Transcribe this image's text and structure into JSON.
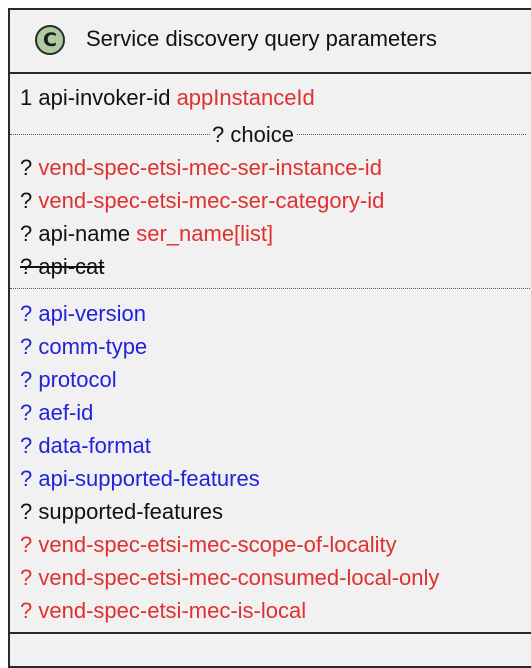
{
  "class": {
    "stereotype": "C",
    "name": "Service discovery query parameters",
    "stereotype_color": "#adcaa1",
    "background_color": "#f1f1f1"
  },
  "colors": {
    "red": "#e0302f",
    "blue": "#2222dd",
    "black": "#111111"
  },
  "rows": {
    "api_invoker": {
      "multiplicity": "1",
      "name": "api-invoker-id",
      "type": "appInstanceId"
    },
    "choice_label": "? choice",
    "ser_instance": {
      "multiplicity": "?",
      "name": "vend-spec-etsi-mec-ser-instance-id"
    },
    "ser_category": {
      "multiplicity": "?",
      "name": "vend-spec-etsi-mec-ser-category-id"
    },
    "api_name": {
      "multiplicity": "?",
      "name": "api-name",
      "type": "ser_name[list]"
    },
    "api_cat": {
      "text": "? api-cat"
    },
    "api_version": {
      "multiplicity": "?",
      "name": "api-version"
    },
    "comm_type": {
      "multiplicity": "?",
      "name": "comm-type"
    },
    "protocol": {
      "multiplicity": "?",
      "name": "protocol"
    },
    "aef_id": {
      "multiplicity": "?",
      "name": "aef-id"
    },
    "data_format": {
      "multiplicity": "?",
      "name": "data-format"
    },
    "api_supported_features": {
      "multiplicity": "?",
      "name": "api-supported-features"
    },
    "supported_features": {
      "multiplicity": "?",
      "name": "supported-features"
    },
    "scope_of_locality": {
      "multiplicity": "?",
      "name": "vend-spec-etsi-mec-scope-of-locality"
    },
    "consumed_local_only": {
      "multiplicity": "?",
      "name": "vend-spec-etsi-mec-consumed-local-only"
    },
    "is_local": {
      "multiplicity": "?",
      "name": "vend-spec-etsi-mec-is-local"
    }
  }
}
